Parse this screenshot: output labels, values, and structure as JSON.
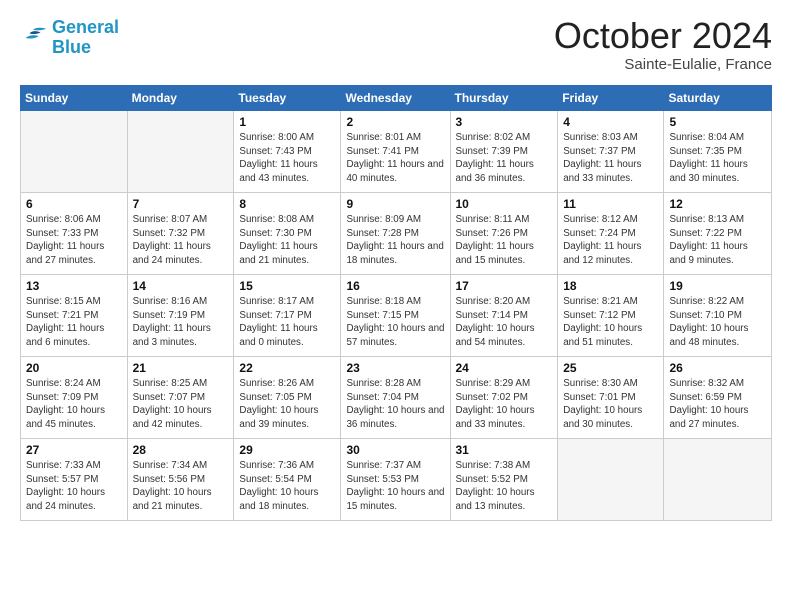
{
  "header": {
    "logo": {
      "line1": "General",
      "line2": "Blue"
    },
    "title": "October 2024",
    "location": "Sainte-Eulalie, France"
  },
  "weekdays": [
    "Sunday",
    "Monday",
    "Tuesday",
    "Wednesday",
    "Thursday",
    "Friday",
    "Saturday"
  ],
  "weeks": [
    [
      {
        "empty": true
      },
      {
        "empty": true
      },
      {
        "day": 1,
        "sunrise": "8:00 AM",
        "sunset": "7:43 PM",
        "daylight": "11 hours and 43 minutes."
      },
      {
        "day": 2,
        "sunrise": "8:01 AM",
        "sunset": "7:41 PM",
        "daylight": "11 hours and 40 minutes."
      },
      {
        "day": 3,
        "sunrise": "8:02 AM",
        "sunset": "7:39 PM",
        "daylight": "11 hours and 36 minutes."
      },
      {
        "day": 4,
        "sunrise": "8:03 AM",
        "sunset": "7:37 PM",
        "daylight": "11 hours and 33 minutes."
      },
      {
        "day": 5,
        "sunrise": "8:04 AM",
        "sunset": "7:35 PM",
        "daylight": "11 hours and 30 minutes."
      }
    ],
    [
      {
        "day": 6,
        "sunrise": "8:06 AM",
        "sunset": "7:33 PM",
        "daylight": "11 hours and 27 minutes."
      },
      {
        "day": 7,
        "sunrise": "8:07 AM",
        "sunset": "7:32 PM",
        "daylight": "11 hours and 24 minutes."
      },
      {
        "day": 8,
        "sunrise": "8:08 AM",
        "sunset": "7:30 PM",
        "daylight": "11 hours and 21 minutes."
      },
      {
        "day": 9,
        "sunrise": "8:09 AM",
        "sunset": "7:28 PM",
        "daylight": "11 hours and 18 minutes."
      },
      {
        "day": 10,
        "sunrise": "8:11 AM",
        "sunset": "7:26 PM",
        "daylight": "11 hours and 15 minutes."
      },
      {
        "day": 11,
        "sunrise": "8:12 AM",
        "sunset": "7:24 PM",
        "daylight": "11 hours and 12 minutes."
      },
      {
        "day": 12,
        "sunrise": "8:13 AM",
        "sunset": "7:22 PM",
        "daylight": "11 hours and 9 minutes."
      }
    ],
    [
      {
        "day": 13,
        "sunrise": "8:15 AM",
        "sunset": "7:21 PM",
        "daylight": "11 hours and 6 minutes."
      },
      {
        "day": 14,
        "sunrise": "8:16 AM",
        "sunset": "7:19 PM",
        "daylight": "11 hours and 3 minutes."
      },
      {
        "day": 15,
        "sunrise": "8:17 AM",
        "sunset": "7:17 PM",
        "daylight": "11 hours and 0 minutes."
      },
      {
        "day": 16,
        "sunrise": "8:18 AM",
        "sunset": "7:15 PM",
        "daylight": "10 hours and 57 minutes."
      },
      {
        "day": 17,
        "sunrise": "8:20 AM",
        "sunset": "7:14 PM",
        "daylight": "10 hours and 54 minutes."
      },
      {
        "day": 18,
        "sunrise": "8:21 AM",
        "sunset": "7:12 PM",
        "daylight": "10 hours and 51 minutes."
      },
      {
        "day": 19,
        "sunrise": "8:22 AM",
        "sunset": "7:10 PM",
        "daylight": "10 hours and 48 minutes."
      }
    ],
    [
      {
        "day": 20,
        "sunrise": "8:24 AM",
        "sunset": "7:09 PM",
        "daylight": "10 hours and 45 minutes."
      },
      {
        "day": 21,
        "sunrise": "8:25 AM",
        "sunset": "7:07 PM",
        "daylight": "10 hours and 42 minutes."
      },
      {
        "day": 22,
        "sunrise": "8:26 AM",
        "sunset": "7:05 PM",
        "daylight": "10 hours and 39 minutes."
      },
      {
        "day": 23,
        "sunrise": "8:28 AM",
        "sunset": "7:04 PM",
        "daylight": "10 hours and 36 minutes."
      },
      {
        "day": 24,
        "sunrise": "8:29 AM",
        "sunset": "7:02 PM",
        "daylight": "10 hours and 33 minutes."
      },
      {
        "day": 25,
        "sunrise": "8:30 AM",
        "sunset": "7:01 PM",
        "daylight": "10 hours and 30 minutes."
      },
      {
        "day": 26,
        "sunrise": "8:32 AM",
        "sunset": "6:59 PM",
        "daylight": "10 hours and 27 minutes."
      }
    ],
    [
      {
        "day": 27,
        "sunrise": "7:33 AM",
        "sunset": "5:57 PM",
        "daylight": "10 hours and 24 minutes."
      },
      {
        "day": 28,
        "sunrise": "7:34 AM",
        "sunset": "5:56 PM",
        "daylight": "10 hours and 21 minutes."
      },
      {
        "day": 29,
        "sunrise": "7:36 AM",
        "sunset": "5:54 PM",
        "daylight": "10 hours and 18 minutes."
      },
      {
        "day": 30,
        "sunrise": "7:37 AM",
        "sunset": "5:53 PM",
        "daylight": "10 hours and 15 minutes."
      },
      {
        "day": 31,
        "sunrise": "7:38 AM",
        "sunset": "5:52 PM",
        "daylight": "10 hours and 13 minutes."
      },
      {
        "empty": true
      },
      {
        "empty": true
      }
    ]
  ],
  "labels": {
    "sunrise": "Sunrise:",
    "sunset": "Sunset:",
    "daylight": "Daylight:"
  }
}
